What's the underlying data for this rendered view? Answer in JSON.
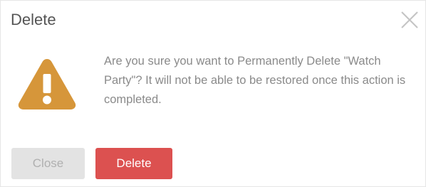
{
  "dialog": {
    "title": "Delete",
    "message": "Are you sure you want to Permanently Delete \"Watch Party\"? It will not be able to be restored once this action is completed.",
    "close_icon": "close-x-icon",
    "warning_icon": "warning-triangle-icon",
    "buttons": {
      "close_label": "Close",
      "delete_label": "Delete"
    },
    "colors": {
      "warning": "#d6963a",
      "delete_button": "#dc5150",
      "close_button": "#e3e3e3"
    }
  }
}
